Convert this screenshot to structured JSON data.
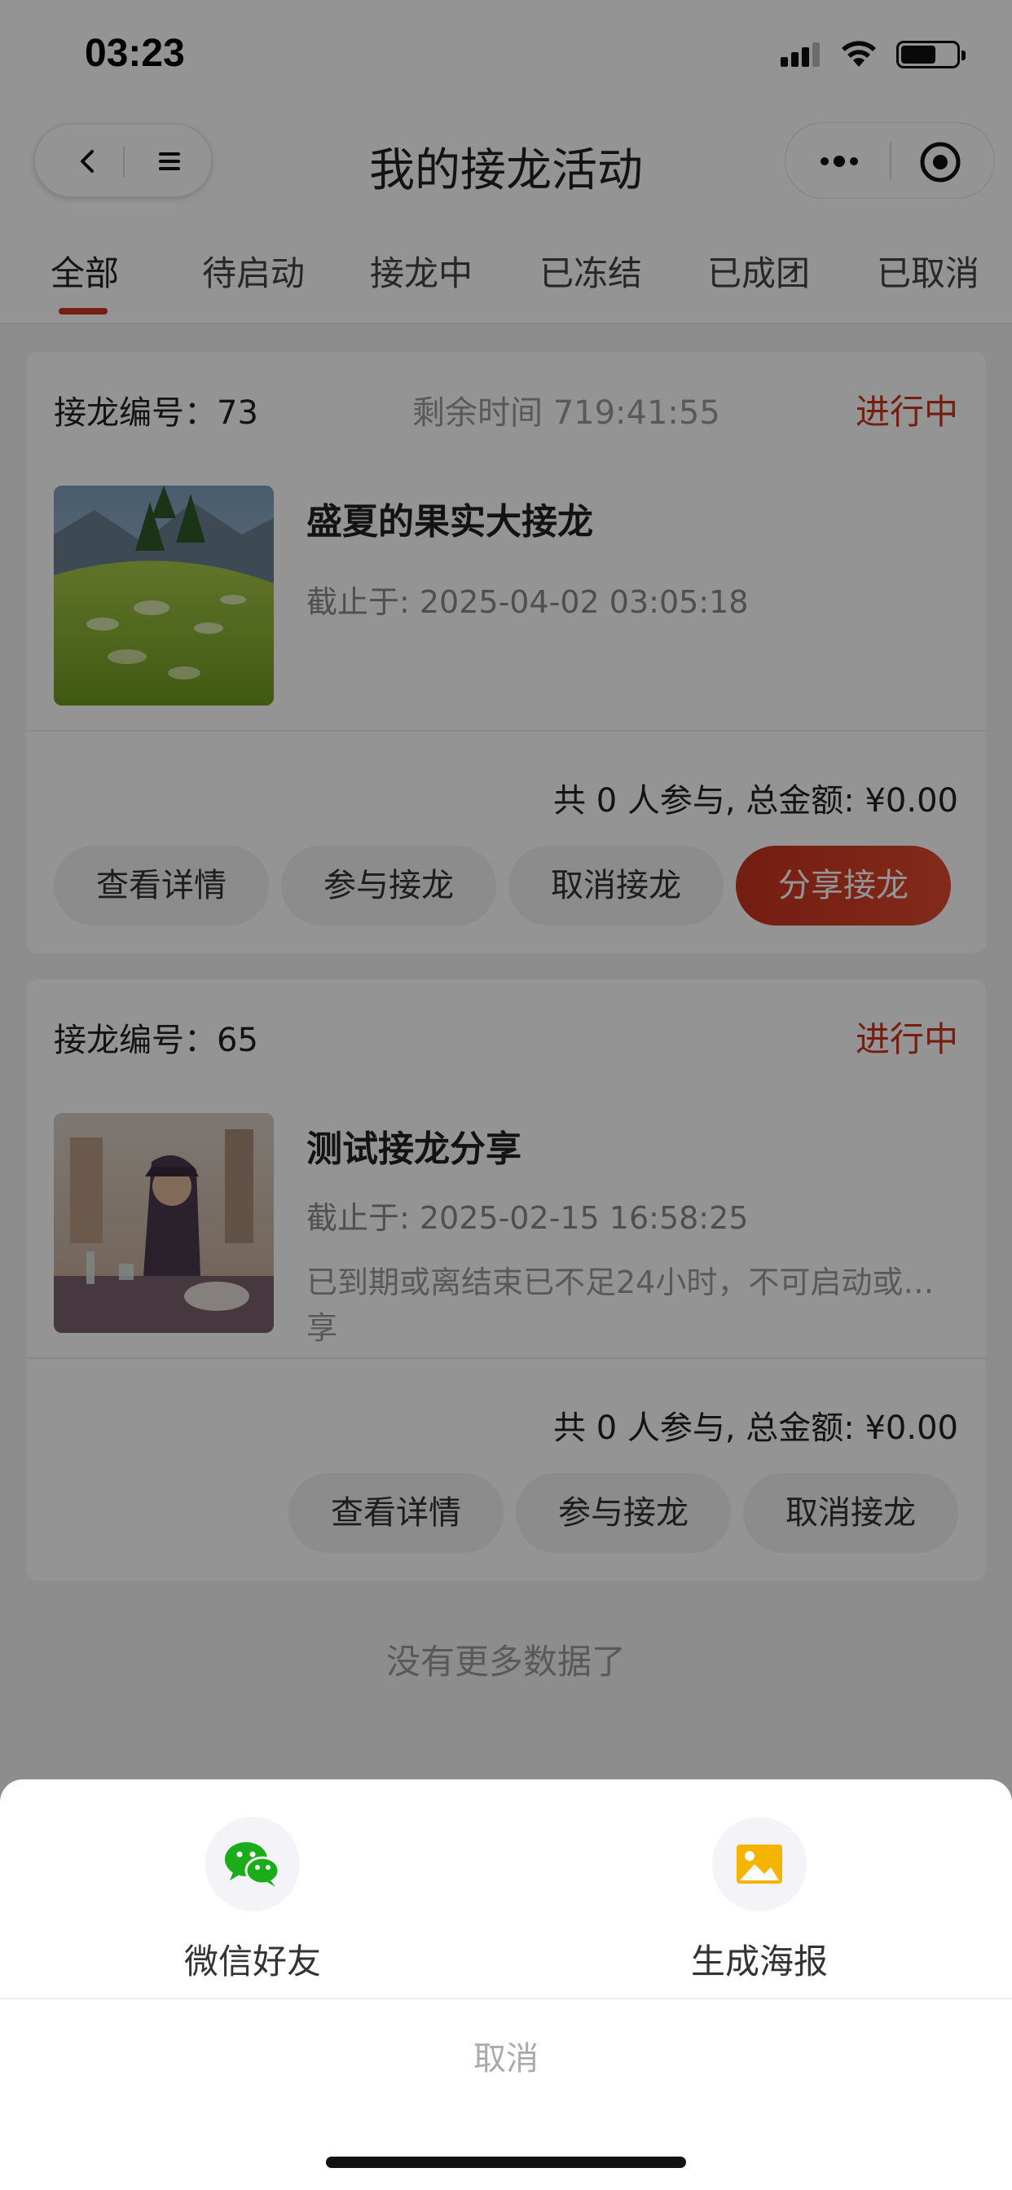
{
  "status_bar": {
    "time": "03:23"
  },
  "nav": {
    "title": "我的接龙活动"
  },
  "tabs": [
    "全部",
    "待启动",
    "接龙中",
    "已冻结",
    "已成团",
    "已取消"
  ],
  "cards": [
    {
      "no_label": "接龙编号：73",
      "remaining": "剩余时间 719:41:55",
      "status": "进行中",
      "title": "盛夏的果实大接龙",
      "deadline": "截止于: 2025-04-02 03:05:18",
      "summary": "共 0 人参与, 总金额: ¥0.00",
      "buttons": [
        "查看详情",
        "参与接龙",
        "取消接龙",
        "分享接龙"
      ]
    },
    {
      "no_label": "接龙编号：65",
      "status": "进行中",
      "title": "测试接龙分享",
      "deadline": "截止于: 2025-02-15 16:58:25",
      "note": "已到期或离结束已不足24小时，不可启动或…",
      "note2": "享",
      "summary": "共 0 人参与, 总金额: ¥0.00",
      "buttons": [
        "查看详情",
        "参与接龙",
        "取消接龙"
      ]
    }
  ],
  "list_footer": "没有更多数据了",
  "share_sheet": {
    "options": [
      {
        "label": "微信好友",
        "icon": "wechat-icon"
      },
      {
        "label": "生成海报",
        "icon": "image-icon"
      }
    ],
    "cancel": "取消"
  },
  "colors": {
    "accent": "#c8321e",
    "wechat": "#1aad19",
    "poster": "#f5b400"
  }
}
